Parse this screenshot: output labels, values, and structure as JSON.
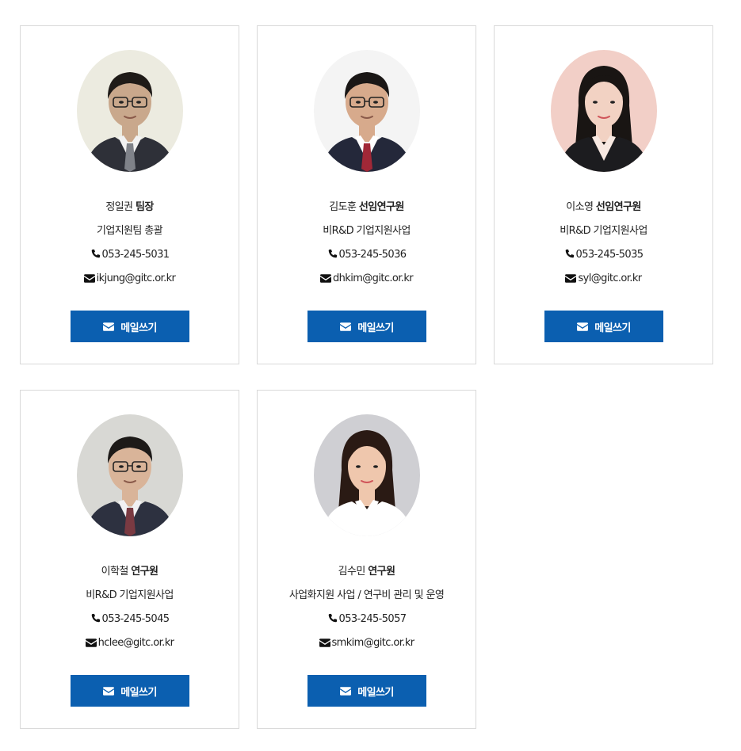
{
  "staff": [
    {
      "name": "정일권",
      "title": "팀장",
      "role": "기업지원팀 총괄",
      "phone": "053-245-5031",
      "email": "ikjung@gitc.or.kr",
      "button_label": "메일쓰기",
      "photo": {
        "bg": "#ecebe0",
        "skin": "#c9a88c",
        "hair": "#1f1b18",
        "suit": "#2e3038",
        "shirt": "#f2f2f2",
        "tie": "#7f8289",
        "glasses": true,
        "gender": "male"
      }
    },
    {
      "name": "김도훈",
      "title": "선임연구원",
      "role": "비R&D 기업지원사업",
      "phone": "053-245-5036",
      "email": "dhkim@gitc.or.kr",
      "button_label": "메일쓰기",
      "photo": {
        "bg": "#f4f4f4",
        "skin": "#d7aa8c",
        "hair": "#1a1716",
        "suit": "#24283a",
        "shirt": "#ffffff",
        "tie": "#a12837",
        "glasses": true,
        "gender": "male"
      }
    },
    {
      "name": "이소영",
      "title": "선임연구원",
      "role": "비R&D 기업지원사업",
      "phone": "053-245-5035",
      "email": "syl@gitc.or.kr",
      "button_label": "메일쓰기",
      "photo": {
        "bg": "#f2cfc7",
        "skin": "#f2d2c3",
        "hair": "#191513",
        "suit": "#1c1c1f",
        "shirt": "#f7e8e1",
        "tie": "",
        "glasses": false,
        "gender": "female"
      }
    },
    {
      "name": "이학철",
      "title": "연구원",
      "role": "비R&D 기업지원사업",
      "phone": "053-245-5045",
      "email": "hclee@gitc.or.kr",
      "button_label": "메일쓰기",
      "photo": {
        "bg": "#d8d8d4",
        "skin": "#d9b499",
        "hair": "#1d1a18",
        "suit": "#2d3140",
        "shirt": "#f1f1f3",
        "tie": "#7a3a42",
        "glasses": true,
        "gender": "male"
      }
    },
    {
      "name": "김수민",
      "title": "연구원",
      "role": "사업화지원 사업 / 연구비 관리 및 운영",
      "phone": "053-245-5057",
      "email": "smkim@gitc.or.kr",
      "button_label": "메일쓰기",
      "photo": {
        "bg": "#cfcfd3",
        "skin": "#efc7ad",
        "hair": "#2a1a14",
        "suit": "#ffffff",
        "shirt": "#ffffff",
        "tie": "",
        "glasses": false,
        "gender": "female"
      }
    }
  ],
  "icons": {
    "phone": "phone-icon",
    "email": "envelope-icon",
    "button": "envelope-icon"
  },
  "colors": {
    "button_bg": "#0b5fb0",
    "button_text": "#ffffff",
    "card_border": "#d9d9d9",
    "text": "#222222"
  }
}
